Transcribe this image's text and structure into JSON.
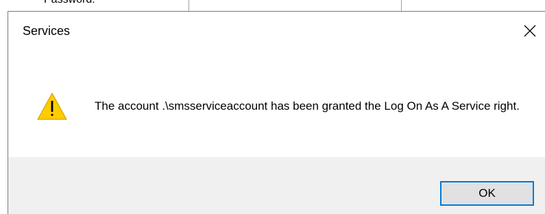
{
  "background_window": {
    "label": "Password:"
  },
  "dialog": {
    "title": "Services",
    "close_icon": "close-icon",
    "icon": "warning-icon",
    "message": "The account .\\smsserviceaccount has been granted the Log On As A Service right.",
    "ok_label": "OK"
  },
  "colors": {
    "accent": "#0078d7",
    "warning_fill": "#ffcc00",
    "footer_bg": "#f0f0f0",
    "button_bg": "#e1e1e1"
  }
}
